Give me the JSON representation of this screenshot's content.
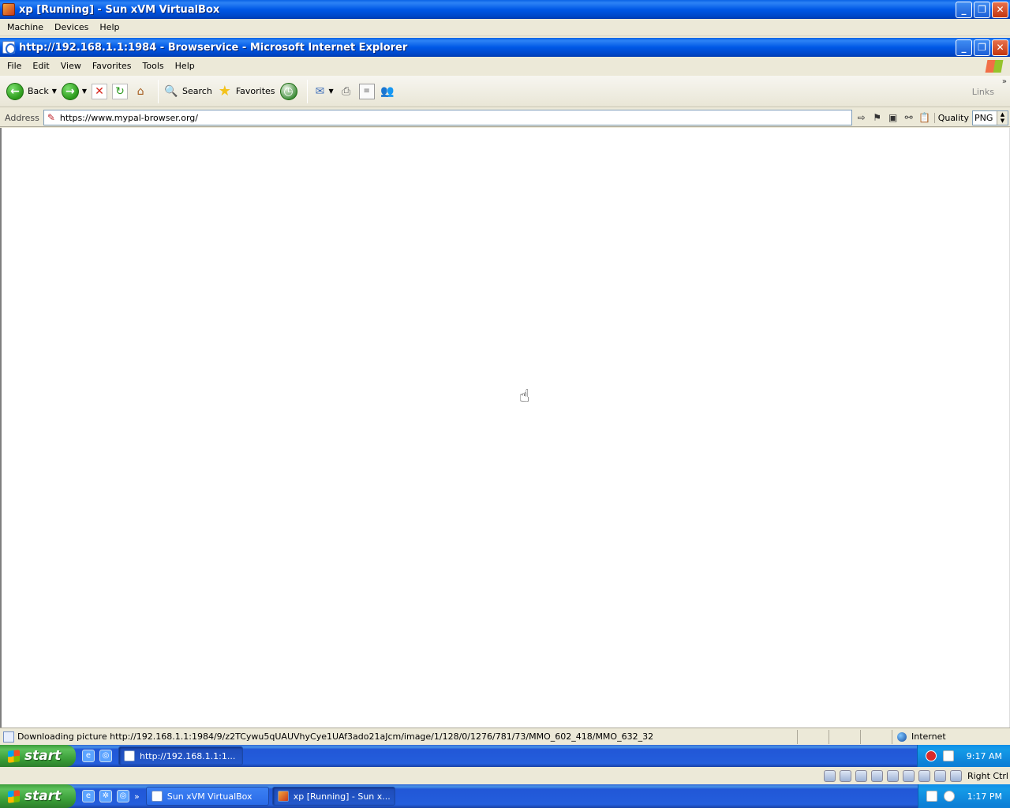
{
  "vbox": {
    "title": "xp [Running] - Sun xVM VirtualBox",
    "menu": [
      "Machine",
      "Devices",
      "Help"
    ],
    "hostkey": "Right Ctrl"
  },
  "ie": {
    "title": "http://192.168.1.1:1984 - Browservice - Microsoft Internet Explorer",
    "menu": [
      "File",
      "Edit",
      "View",
      "Favorites",
      "Tools",
      "Help"
    ],
    "toolbar": {
      "back_label": "Back",
      "search_label": "Search",
      "favorites_label": "Favorites",
      "links_label": "Links"
    },
    "address": {
      "label": "Address",
      "url": "https://www.mypal-browser.org/",
      "quality_label": "Quality",
      "quality_value": "PNG"
    },
    "status": {
      "text": "Downloading picture http://192.168.1.1:1984/9/z2TCywu5qUAUVhyCye1UAf3ado21aJcm/image/1/128/0/1276/781/73/MMO_602_418/MMO_632_32",
      "zone": "Internet"
    }
  },
  "guest_taskbar": {
    "start_label": "start",
    "task_label": "http://192.168.1.1:1...",
    "clock": "9:17 AM"
  },
  "host_taskbar": {
    "start_label": "start",
    "tasks": [
      "Sun xVM VirtualBox",
      "xp [Running] - Sun x..."
    ],
    "clock": "1:17 PM"
  }
}
